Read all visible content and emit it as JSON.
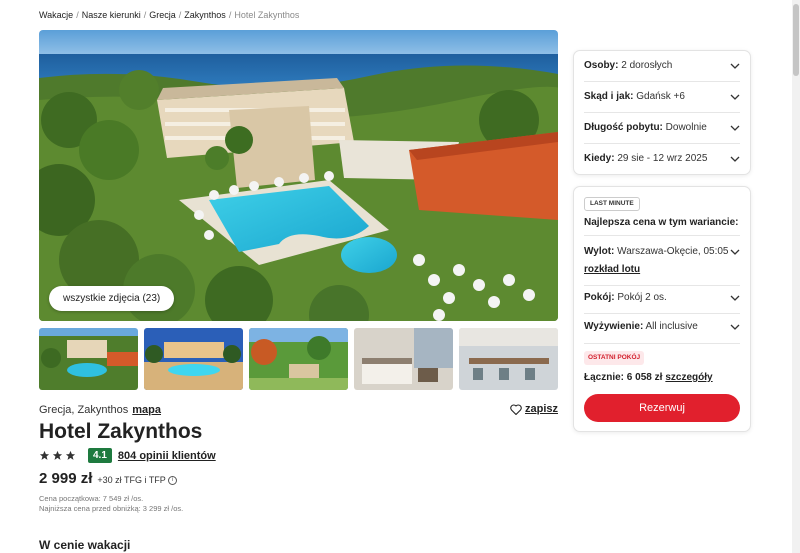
{
  "breadcrumb": [
    "Wakacje",
    "Nasze kierunki",
    "Grecja",
    "Zakynthos"
  ],
  "breadcrumb_current": "Hotel Zakynthos",
  "gallery": {
    "all_photos_label": "wszystkie zdjęcia (23)"
  },
  "hotel": {
    "location": "Grecja, Zakynthos",
    "map_label": "mapa",
    "save_label": "zapisz",
    "name": "Hotel Zakynthos",
    "stars": 3,
    "score": "4.1",
    "reviews_label": "804 opinii klientów"
  },
  "price": {
    "main": "2 999 zł",
    "extra": "+30 zł TFG i TFP",
    "starting_price": "Cena początkowa: 7 549 zł /os.",
    "lowest_price": "Najniższa cena przed obniżką: 3 299 zł /os."
  },
  "section_heading": "W cenie wakacji",
  "filters": [
    {
      "label": "Osoby:",
      "value": "2 dorosłych"
    },
    {
      "label": "Skąd i jak:",
      "value": "Gdańsk +6"
    },
    {
      "label": "Długość pobytu:",
      "value": "Dowolnie"
    },
    {
      "label": "Kiedy:",
      "value": "29 sie - 12 wrz 2025"
    }
  ],
  "offer": {
    "badge": "LAST MINUTE",
    "heading": "Najlepsza cena w tym wariancie:",
    "flight_label": "Wylot:",
    "flight_value": "Warszawa-Okęcie, 05:05",
    "flight_link": "rozkład lotu",
    "room_label": "Pokój:",
    "room_value": "Pokój 2 os.",
    "board_label": "Wyżywienie:",
    "board_value": "All inclusive",
    "last_room_badge": "OSTATNI POKÓJ",
    "total_label": "Łącznie: 6 058 zł",
    "details_link": "szczegóły",
    "book_label": "Rezerwuj"
  },
  "colors": {
    "accent": "#e1202d",
    "score": "#1e7a3f",
    "last_room_bg": "#fde8ea"
  }
}
